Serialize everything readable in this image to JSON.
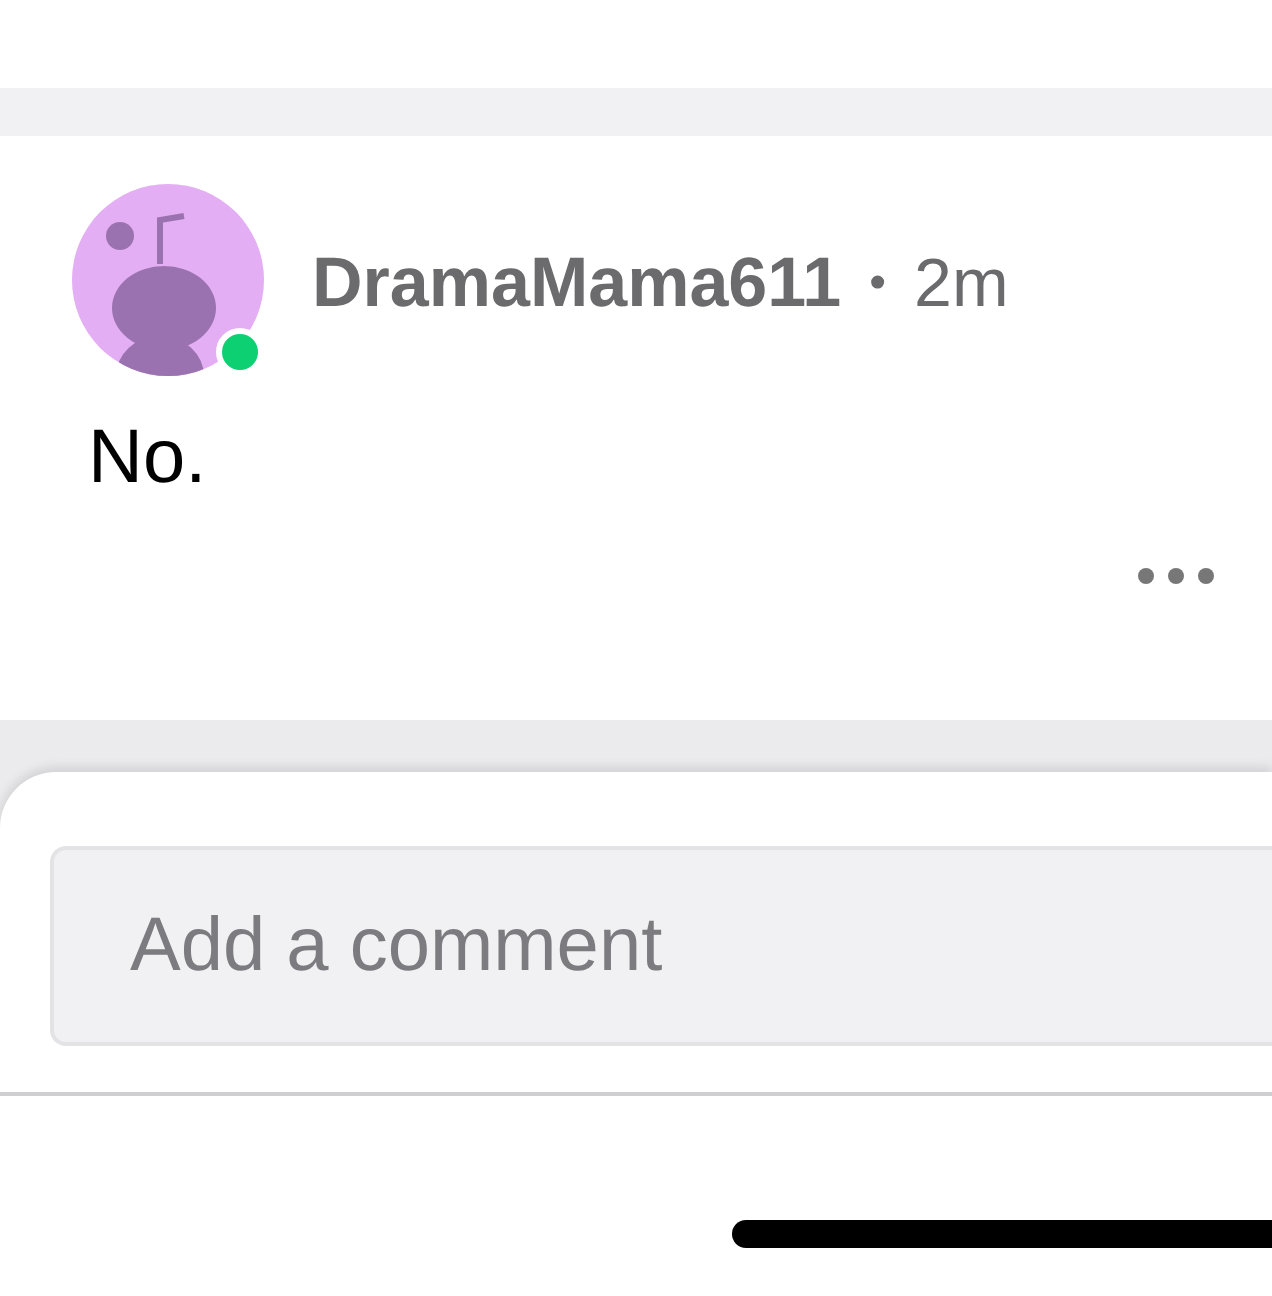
{
  "post": {
    "author": "DramaMama611",
    "separator": "•",
    "time": "2m",
    "author_online": true,
    "body": "No."
  },
  "comment_box": {
    "placeholder": "Add a comment"
  }
}
